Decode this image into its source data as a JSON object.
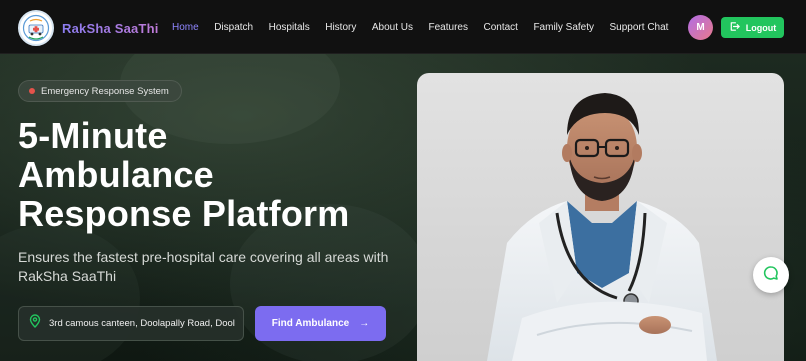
{
  "brand": {
    "name": "RakSha SaaThi"
  },
  "nav": {
    "items": [
      {
        "label": "Home",
        "active": true
      },
      {
        "label": "Dispatch",
        "active": false
      },
      {
        "label": "Hospitals",
        "active": false
      },
      {
        "label": "History",
        "active": false
      },
      {
        "label": "About Us",
        "active": false
      },
      {
        "label": "Features",
        "active": false
      },
      {
        "label": "Contact",
        "active": false
      },
      {
        "label": "Family Safety",
        "active": false
      },
      {
        "label": "Support Chat",
        "active": false
      }
    ],
    "avatar_initial": "M",
    "logout_label": "Logout"
  },
  "hero": {
    "badge": "Emergency Response System",
    "title_lines": [
      "5-Minute",
      "Ambulance",
      "Response Platform"
    ],
    "subtitle": "Ensures the fastest pre-hospital care covering all areas with RakSha SaaThi",
    "location_value": "3rd camous canteen, Doolapally Road, Dool",
    "find_button": "Find Ambulance",
    "arrow": "→"
  },
  "icons": {
    "logout": "logout-icon",
    "location": "map-pin-icon",
    "chat": "chat-bubble-icon"
  },
  "colors": {
    "accent": "#7c6cf0",
    "nav_active": "#8f86ff",
    "logout_green": "#22c55e",
    "badge_dot": "#e5534b",
    "location_pin": "#22c55e",
    "chat_icon": "#22c55e"
  }
}
